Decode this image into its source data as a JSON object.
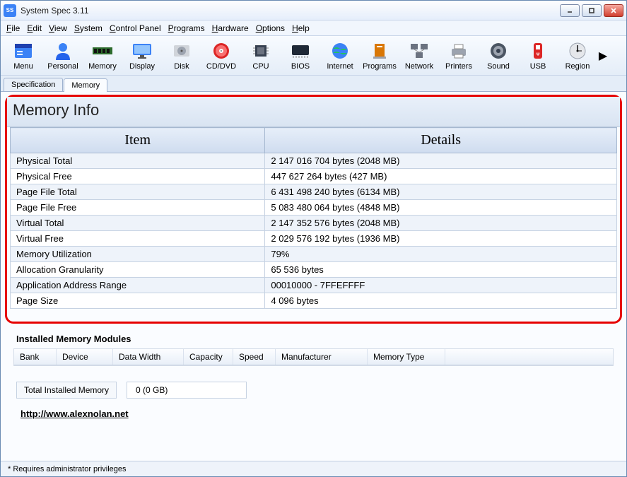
{
  "window": {
    "title": "System Spec 3.11"
  },
  "menubar": [
    "File",
    "Edit",
    "View",
    "System",
    "Control Panel",
    "Programs",
    "Hardware",
    "Options",
    "Help"
  ],
  "toolbar": [
    {
      "label": "Menu",
      "icon": "menu"
    },
    {
      "label": "Personal",
      "icon": "personal"
    },
    {
      "label": "Memory",
      "icon": "memory"
    },
    {
      "label": "Display",
      "icon": "display"
    },
    {
      "label": "Disk",
      "icon": "disk"
    },
    {
      "label": "CD/DVD",
      "icon": "cddvd"
    },
    {
      "label": "CPU",
      "icon": "cpu"
    },
    {
      "label": "BIOS",
      "icon": "bios"
    },
    {
      "label": "Internet",
      "icon": "internet"
    },
    {
      "label": "Programs",
      "icon": "programs"
    },
    {
      "label": "Network",
      "icon": "network"
    },
    {
      "label": "Printers",
      "icon": "printers"
    },
    {
      "label": "Sound",
      "icon": "sound"
    },
    {
      "label": "USB",
      "icon": "usb"
    },
    {
      "label": "Region",
      "icon": "region"
    }
  ],
  "tabs": [
    {
      "label": "Specification",
      "active": false
    },
    {
      "label": "Memory",
      "active": true
    }
  ],
  "panel": {
    "title": "Memory Info",
    "columns": [
      "Item",
      "Details"
    ],
    "rows": [
      {
        "item": "Physical Total",
        "details": "2 147 016 704 bytes   (2048 MB)"
      },
      {
        "item": "Physical Free",
        "details": "447 627 264 bytes   (427 MB)"
      },
      {
        "item": "Page File Total",
        "details": "6 431 498 240 bytes   (6134 MB)"
      },
      {
        "item": "Page File Free",
        "details": "5 083 480 064 bytes   (4848 MB)"
      },
      {
        "item": "Virtual Total",
        "details": "2 147 352 576 bytes   (2048 MB)"
      },
      {
        "item": "Virtual Free",
        "details": "2 029 576 192 bytes   (1936 MB)"
      },
      {
        "item": "Memory Utilization",
        "details": "79%"
      },
      {
        "item": "Allocation Granularity",
        "details": "65 536 bytes"
      },
      {
        "item": "Application Address Range",
        "details": "00010000 - 7FFEFFFF"
      },
      {
        "item": "Page Size",
        "details": "4 096 bytes"
      }
    ]
  },
  "modules": {
    "title": "Installed Memory Modules",
    "columns": [
      "Bank",
      "Device",
      "Data Width",
      "Capacity",
      "Speed",
      "Manufacturer",
      "Memory Type"
    ]
  },
  "total": {
    "label": "Total Installed Memory",
    "value": "0 (0 GB)"
  },
  "link": "http://www.alexnolan.net",
  "status": "*  Requires administrator privileges",
  "colors": {
    "accent": "#3b82f6",
    "highlight": "#e60000"
  }
}
